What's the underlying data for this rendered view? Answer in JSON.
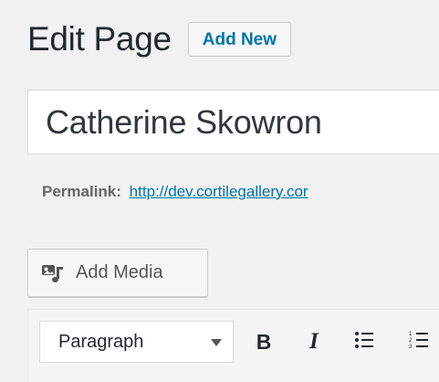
{
  "header": {
    "title": "Edit Page",
    "add_new_label": "Add New"
  },
  "post_title": {
    "value": "Catherine Skowron"
  },
  "permalink": {
    "label": "Permalink:",
    "url": "http://dev.cortilegallery.cor"
  },
  "media": {
    "add_media_label": "Add Media",
    "icon": "media-icon"
  },
  "toolbar": {
    "format_value": "Paragraph",
    "bold_label": "B",
    "italic_label": "I",
    "icons": [
      "chevron-down-icon",
      "bold-icon",
      "italic-icon",
      "bulleted-list-icon",
      "numbered-list-icon"
    ]
  },
  "colors": {
    "background": "#f1f1f1",
    "link": "#0073aa",
    "text": "#23282d"
  }
}
